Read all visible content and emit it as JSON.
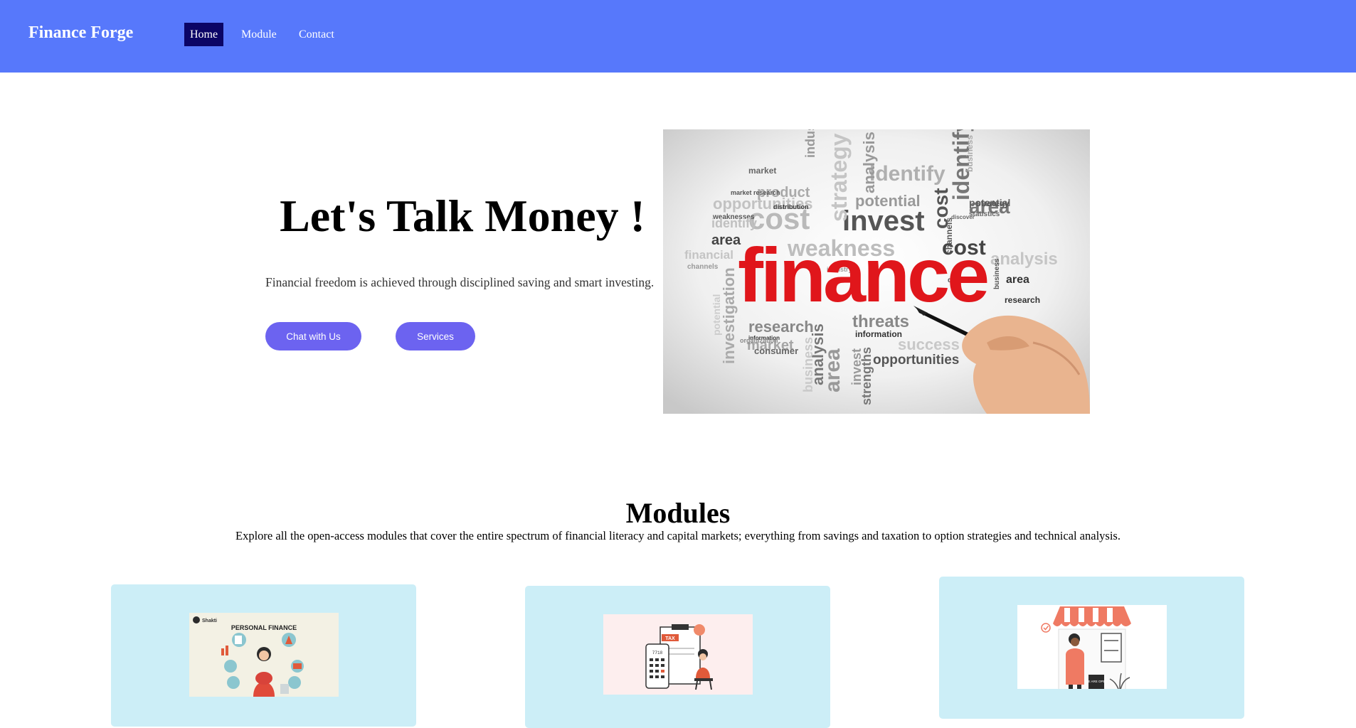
{
  "header": {
    "brand": "Finance Forge",
    "nav": [
      {
        "label": "Home",
        "active": true
      },
      {
        "label": "Module",
        "active": false
      },
      {
        "label": "Contact",
        "active": false
      }
    ],
    "bg_color": "#5778fb",
    "active_color": "#0b0566"
  },
  "hero": {
    "title": "Let's Talk Money !",
    "subtitle": "Financial freedom is achieved through disciplined saving and smart investing.",
    "buttons": {
      "chat": "Chat with Us",
      "services": "Services"
    },
    "button_color": "#6c63f0",
    "image": {
      "headline_word": "finance",
      "words": [
        "cost",
        "invest",
        "identify",
        "area",
        "weakness",
        "strategy",
        "potential",
        "analysis",
        "research",
        "threats",
        "opportunities",
        "success",
        "product",
        "industry",
        "market",
        "information",
        "consumer",
        "strengths",
        "business",
        "investigation",
        "financial",
        "market research",
        "distribution",
        "statistics",
        "discover",
        "definition",
        "organization",
        "channels",
        "weaknesses"
      ]
    }
  },
  "modules": {
    "title": "Modules",
    "subtitle": "Explore all the open-access modules that cover the entire spectrum of financial literacy and capital markets; everything from savings and taxation to option strategies and technical analysis.",
    "card_color": "#cceef7",
    "cards": [
      {
        "image_text": "PERSONAL FINANCE",
        "logo_text": "Shakti"
      },
      {
        "image_text": "TAX",
        "calc_text": "7718"
      },
      {
        "image_text": "WE ARE OPEN"
      }
    ]
  }
}
